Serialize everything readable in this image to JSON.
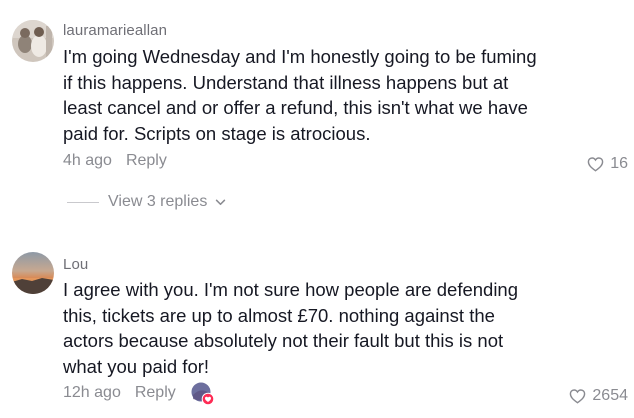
{
  "comments": [
    {
      "username": "lauramarieallan",
      "lines": [
        "I'm going Wednesday and I'm honestly going to be fuming",
        "if this happens. Understand that illness happens but at",
        "least cancel and or offer a refund, this isn't what we have",
        "paid for. Scripts on stage is atrocious."
      ],
      "time": "4h ago",
      "reply_label": "Reply",
      "likes": "16",
      "view_replies": "View 3 replies"
    },
    {
      "username": "Lou",
      "lines": [
        "I agree with you. I'm not sure how people are defending",
        "this, tickets are up to almost £70. nothing against the",
        "actors because absolutely not their fault but this is not",
        "what you paid for!"
      ],
      "time": "12h ago",
      "reply_label": "Reply",
      "likes": "2654"
    }
  ],
  "icons": {
    "like": "heart-outline-icon",
    "expand": "chevron-down-icon",
    "creator": "creator-liked-badge-icon"
  },
  "colors": {
    "text": "#161823",
    "muted": "#8a8b91",
    "badge_accent": "#fe2c55"
  }
}
